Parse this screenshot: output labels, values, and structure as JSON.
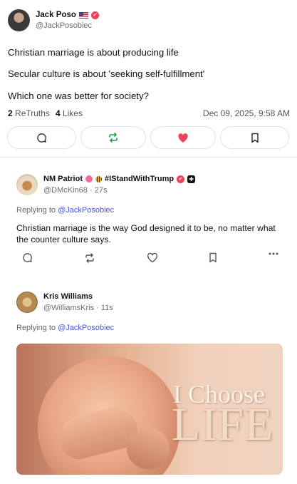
{
  "post": {
    "author_name": "Jack Poso",
    "author_handle": "@JackPosobiec",
    "lines": [
      "Christian marriage is about producing life",
      "Secular culture is about 'seeking self-fulfillment'",
      "Which one was better for society?"
    ],
    "retruths_count": "2",
    "retruths_label": "ReTruths",
    "likes_count": "4",
    "likes_label": "Likes",
    "timestamp": "Dec 09, 2025, 9:58 AM",
    "actions": [
      "reply-icon",
      "retruth-icon",
      "like-icon",
      "bookmark-icon"
    ],
    "colors": {
      "retruth": "#1aa33d",
      "like": "#f0435a",
      "verified": "#f0435a"
    }
  },
  "replies": [
    {
      "name": "NM Patriot",
      "tag": "#IStandWithTrump",
      "handle": "@DMcKin68",
      "age": "27s",
      "replying_prefix": "Replying to",
      "replying_to": "@JackPosobiec",
      "text": "Christian marriage is the way God designed it to be, no matter what the counter culture says."
    },
    {
      "name": "Kris Williams",
      "handle": "@WilliamsKris",
      "age": "11s",
      "replying_prefix": "Replying to",
      "replying_to": "@JackPosobiec",
      "media_text_line1": "I Choose",
      "media_text_line2": "LIFE"
    }
  ],
  "separator": "·",
  "colors": {
    "mention": "#4a52d9",
    "muted": "#6b6b6b"
  }
}
